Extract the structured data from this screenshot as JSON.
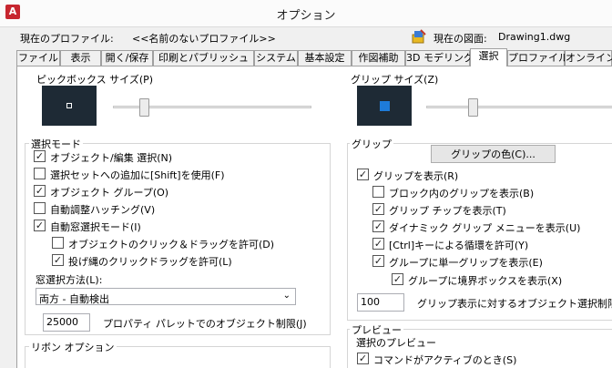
{
  "window": {
    "title": "オプション"
  },
  "profile": {
    "label": "現在のプロファイル:",
    "name": "<<名前のないプロファイル>>",
    "drawing_label": "現在の図面:",
    "drawing_name": "Drawing1.dwg"
  },
  "tabs": [
    "ファイル",
    "表示",
    "開く/保存",
    "印刷とパブリッシュ",
    "システム",
    "基本設定",
    "作図補助",
    "3D モデリング",
    "選択",
    "プロファイル",
    "オンライン"
  ],
  "active_tab": "選択",
  "pickbox": {
    "label": "ピックボックス サイズ(P)"
  },
  "grip_size": {
    "label": "グリップ サイズ(Z)"
  },
  "selection_mode": {
    "label": "選択モード",
    "items": [
      {
        "label": "オブジェクト/編集 選択(N)",
        "checked": true
      },
      {
        "label": "選択セットへの追加に[Shift]を使用(F)",
        "checked": false
      },
      {
        "label": "オブジェクト グループ(O)",
        "checked": true
      },
      {
        "label": "自動調整ハッチング(V)",
        "checked": false
      },
      {
        "label": "自動窓選択モード(I)",
        "checked": true
      },
      {
        "label": "オブジェクトのクリック＆ドラッグを許可(D)",
        "checked": false
      },
      {
        "label": "投げ縄のクリックドラッグを許可(L)",
        "checked": true
      }
    ],
    "window_method_label": "窓選択方法(L):",
    "window_method_value": "両方 - 自動検出",
    "limit_value": "25000",
    "limit_label": "プロパティ パレットでのオブジェクト制限(J)"
  },
  "ribbon": {
    "label": "リボン オプション"
  },
  "grips": {
    "label": "グリップ",
    "color_button": "グリップの色(C)...",
    "items": [
      {
        "label": "グリップを表示(R)",
        "checked": true
      },
      {
        "label": "ブロック内のグリップを表示(B)",
        "checked": false
      },
      {
        "label": "グリップ チップを表示(T)",
        "checked": true
      },
      {
        "label": "ダイナミック グリップ メニューを表示(U)",
        "checked": true
      },
      {
        "label": "[Ctrl]キーによる循環を許可(Y)",
        "checked": true
      },
      {
        "label": "グループに単一グリップを表示(E)",
        "checked": true
      },
      {
        "label": "グループに境界ボックスを表示(X)",
        "checked": true
      }
    ],
    "limit_value": "100",
    "limit_label": "グリップ表示に対するオブジェクト選択制限(M)"
  },
  "preview": {
    "label": "プレビュー",
    "sub_label": "選択のプレビュー",
    "items": [
      {
        "label": "コマンドがアクティブのとき(S)",
        "checked": true
      }
    ]
  },
  "colors": {
    "grip_blue": "#1e7bd9",
    "swatch_bg": "#1e2a35"
  }
}
